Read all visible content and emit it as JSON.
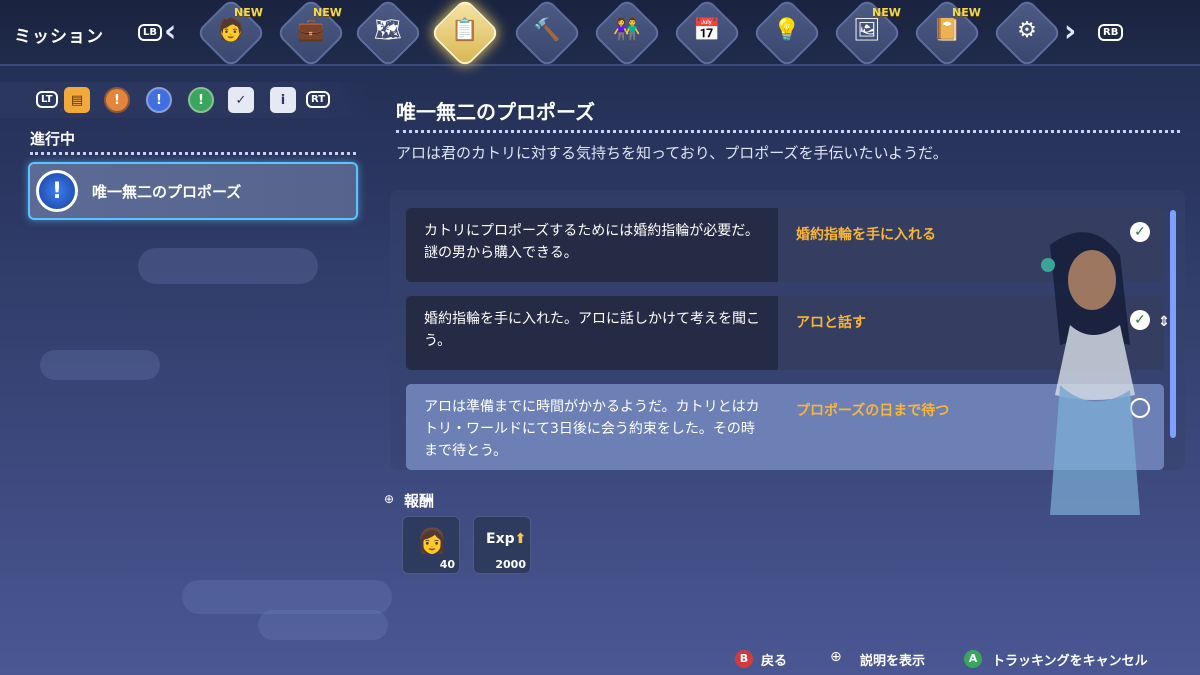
{
  "header": {
    "title": "ミッション",
    "lb_label": "LB",
    "rb_label": "RB",
    "new_label": "NEW",
    "tabs": [
      {
        "icon": "villager-portrait-icon",
        "new": true
      },
      {
        "icon": "satchel-icon",
        "new": true
      },
      {
        "icon": "map-icon",
        "new": false
      },
      {
        "icon": "mission-list-icon",
        "new": false,
        "active": true
      },
      {
        "icon": "hammer-icon",
        "new": false
      },
      {
        "icon": "friends-icon",
        "new": false
      },
      {
        "icon": "calendar-icon",
        "new": false
      },
      {
        "icon": "lightbulb-icon",
        "new": false
      },
      {
        "icon": "photo-album-icon",
        "new": true
      },
      {
        "icon": "journal-icon",
        "new": true
      },
      {
        "icon": "gear-icon",
        "new": false
      }
    ]
  },
  "filters": {
    "lt_label": "LT",
    "rt_label": "RT",
    "icons": [
      "all-missions-icon",
      "orange-mission-icon",
      "blue-mission-icon",
      "green-mission-icon",
      "checklist-icon",
      "info-clipboard-icon"
    ]
  },
  "left": {
    "section_label": "進行中",
    "quest_title": "唯一無二のプロポーズ"
  },
  "detail": {
    "title": "唯一無二のプロポーズ",
    "description": "アロは君のカトリに対する気持ちを知っており、プロポーズを手伝いたいようだ。",
    "objectives": [
      {
        "desc": "カトリにプロポーズするためには婚約指輪が必要だ。謎の男から購入できる。",
        "task": "婚約指輪を手に入れる",
        "done": true
      },
      {
        "desc": "婚約指輪を手に入れた。アロに話しかけて考えを聞こう。",
        "task": "アロと話す",
        "done": true
      },
      {
        "desc": "アロは準備までに時間がかかるようだ。カトリとはカトリ・ワールドにて3日後に会う約束をした。その時まで待とう。",
        "task": "プロポーズの日まで待つ",
        "done": false
      }
    ]
  },
  "rewards": {
    "label": "報酬",
    "items": [
      {
        "icon": "aro-portrait-icon",
        "value": "40"
      },
      {
        "icon": "exp-icon",
        "label": "Exp",
        "value": "2000"
      }
    ]
  },
  "footer": {
    "back_label": "戻る",
    "back_button": "B",
    "show_desc_label": "説明を表示",
    "cancel_tracking_label": "トラッキングをキャンセル",
    "cancel_button": "A"
  },
  "colors": {
    "accent_gold": "#f7b53a",
    "highlight_blue": "#5ec4ff",
    "check_green": "#2b7a37"
  }
}
